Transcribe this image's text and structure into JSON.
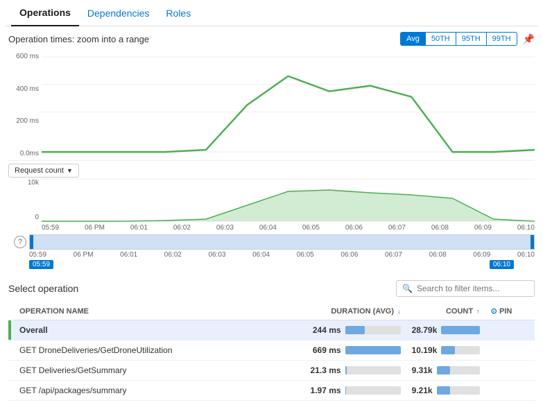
{
  "tabs": [
    {
      "label": "Operations",
      "active": true
    },
    {
      "label": "Dependencies",
      "active": false
    },
    {
      "label": "Roles",
      "active": false
    }
  ],
  "chart": {
    "title": "Operation times: zoom into a range",
    "avg_label": "Avg",
    "pct50_label": "50TH",
    "pct95_label": "95TH",
    "pct99_label": "99TH",
    "y_labels": [
      "600 ms",
      "400 ms",
      "200 ms",
      "0.0ms"
    ],
    "time_labels": [
      "05:59",
      "06 PM",
      "06:01",
      "06:02",
      "06:03",
      "06:04",
      "06:05",
      "06:06",
      "06:07",
      "06:08",
      "06:09",
      "06:10"
    ],
    "mini_y_labels": [
      "10k",
      "0"
    ],
    "dropdown_label": "Request count",
    "range_start": "05:59",
    "range_end": "06:10"
  },
  "select_operation": {
    "title": "Select operation",
    "search_placeholder": "Search to filter items..."
  },
  "table": {
    "columns": [
      {
        "label": "OPERATION NAME",
        "sort": false
      },
      {
        "label": "DURATION (AVG)",
        "sort": true
      },
      {
        "label": "COUNT",
        "sort": true
      },
      {
        "label": "PIN",
        "sort": false
      }
    ],
    "rows": [
      {
        "name": "Overall",
        "duration": "244 ms",
        "duration_pct": 36,
        "count": "28.79k",
        "count_pct": 100,
        "selected": true,
        "indicator": true
      },
      {
        "name": "GET DroneDeliveries/GetDroneUtilization",
        "duration": "669 ms",
        "duration_pct": 100,
        "count": "10.19k",
        "count_pct": 35,
        "selected": false,
        "indicator": false
      },
      {
        "name": "GET Deliveries/GetSummary",
        "duration": "21.3 ms",
        "duration_pct": 3,
        "count": "9.31k",
        "count_pct": 32,
        "selected": false,
        "indicator": false
      },
      {
        "name": "GET /api/packages/summary",
        "duration": "1.97 ms",
        "duration_pct": 0.3,
        "count": "9.21k",
        "count_pct": 32,
        "selected": false,
        "indicator": false
      }
    ]
  }
}
